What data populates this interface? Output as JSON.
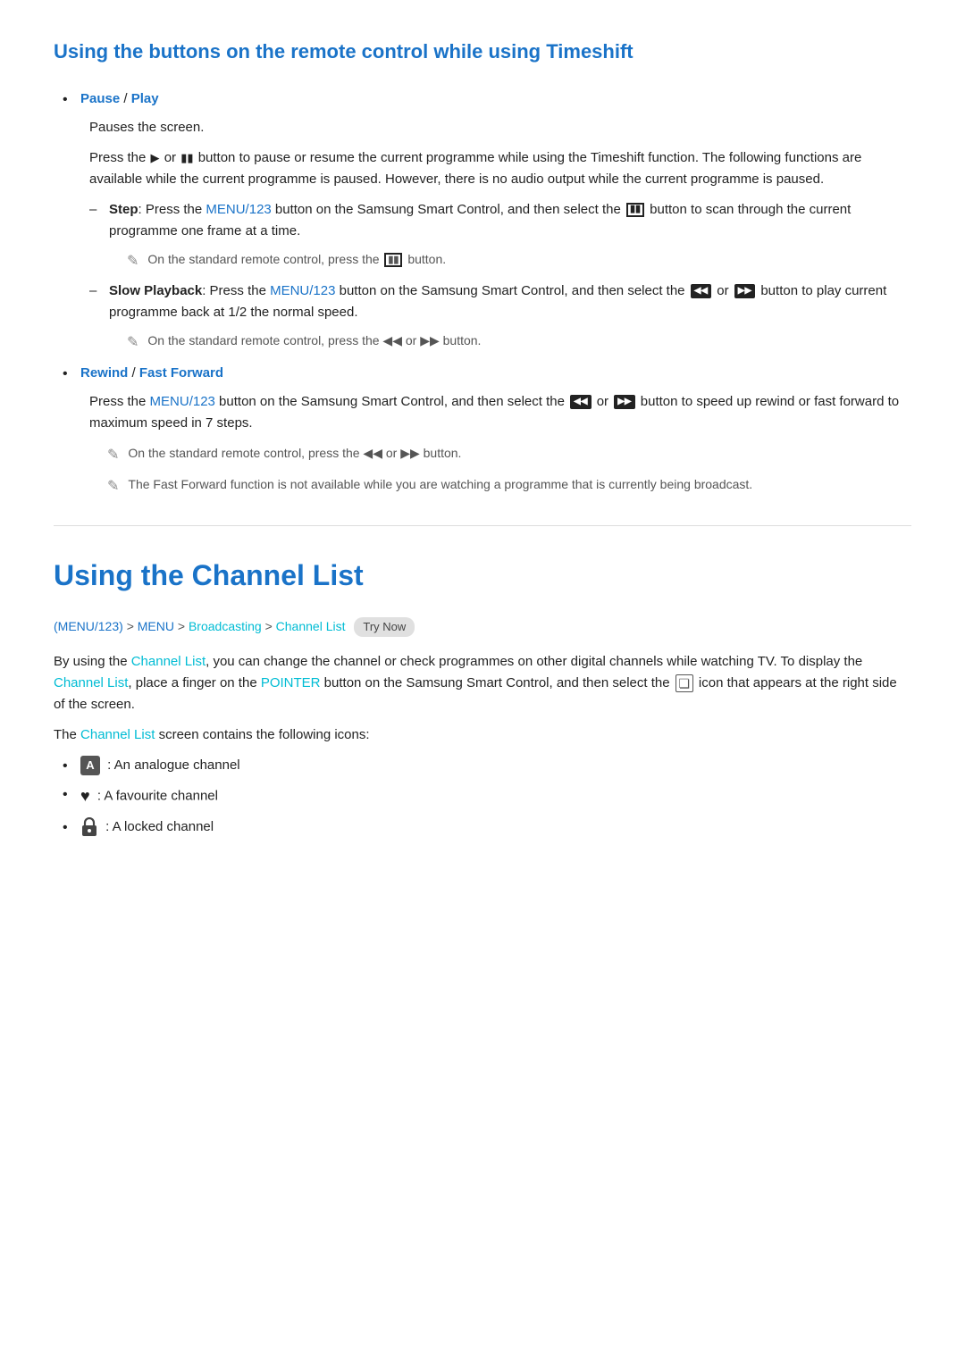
{
  "section1": {
    "title": "Using the buttons on the remote control while using Timeshift",
    "bullet1": {
      "label": "Pause",
      "separator": " / ",
      "label2": "Play",
      "para1": "Pauses the screen.",
      "para2": "Press the ▶ or ⏸ button to pause or resume the current programme while using the Timeshift function. The following functions are available while the current programme is paused. However, there is no audio output while the current programme is paused.",
      "dash1": {
        "bold": "Step",
        "text": ": Press the ",
        "menu": "MENU/123",
        "text2": " button on the Samsung Smart Control, and then select the",
        "text3": "button to scan through the current programme one frame at a time.",
        "note": "On the standard remote control, press the ⏸ button."
      },
      "dash2": {
        "bold": "Slow Playback",
        "text": ": Press the ",
        "menu": "MENU/123",
        "text2": " button on the Samsung Smart Control, and then select the",
        "text3": "or",
        "text4": "button to play current programme back at 1/2 the normal speed.",
        "note": "On the standard remote control, press the ◀◀ or ▶▶ button."
      }
    },
    "bullet2": {
      "label": "Rewind",
      "separator": " / ",
      "label2": "Fast Forward",
      "para1": "Press the ",
      "menu": "MENU/123",
      "para2": " button on the Samsung Smart Control, and then select the",
      "or_text": "or",
      "para3": "button to speed up rewind or fast forward to maximum speed in 7 steps.",
      "note1": "On the standard remote control, press the ◀◀ or ▶▶ button.",
      "note2": "The Fast Forward function is not available while you are watching a programme that is currently being broadcast."
    }
  },
  "section2": {
    "title": "Using the Channel List",
    "breadcrumb": {
      "part1": "(MENU/123)",
      "arrow": " > ",
      "part2": "MENU",
      "part3": "Broadcasting",
      "part4": "Channel List",
      "badge": "Try Now"
    },
    "para1_prefix": "By using the ",
    "channel_list_link1": "Channel List",
    "para1_mid": ", you can change the channel or check programmes on other digital channels while watching TV. To display the ",
    "channel_list_link2": "Channel List",
    "para1_mid2": ", place a finger on the ",
    "pointer_link": "POINTER",
    "para1_end": " button on the Samsung Smart Control, and then select the",
    "para1_end2": "icon that appears at the right side of the screen.",
    "para2": "The ",
    "channel_list_link3": "Channel List",
    "para2_end": " screen contains the following icons:",
    "icons": [
      {
        "icon_type": "A",
        "description": ": An analogue channel"
      },
      {
        "icon_type": "heart",
        "description": ": A favourite channel"
      },
      {
        "icon_type": "lock",
        "description": ": A locked channel"
      }
    ]
  }
}
